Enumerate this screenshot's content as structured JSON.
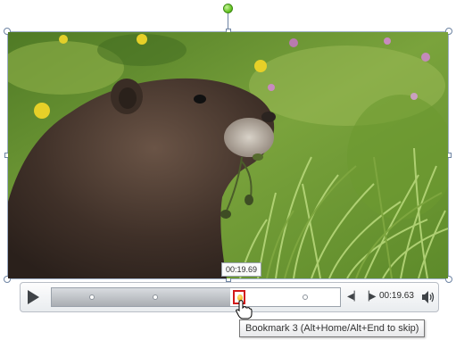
{
  "video": {
    "subject": "marmot-in-grass"
  },
  "player": {
    "current_time": "00:19.63",
    "hover_time": "00:19.69",
    "progress_fraction": 0.62,
    "bookmarks": [
      {
        "position_fraction": 0.14
      },
      {
        "position_fraction": 0.36
      },
      {
        "position_fraction": 0.65,
        "active": true
      },
      {
        "position_fraction": 0.88
      }
    ]
  },
  "tooltip": {
    "bookmark_label": "Bookmark 3 (Alt+Home/Alt+End to skip)"
  },
  "icons": {
    "play": "play-icon",
    "previous": "previous-bookmark-icon",
    "next": "next-bookmark-icon",
    "volume": "volume-icon",
    "cursor": "hand-pointer-icon"
  },
  "colors": {
    "selection_handle": "#6e84a3",
    "rotation_handle": "#62c21f",
    "active_bookmark_border": "#d21a1a"
  }
}
